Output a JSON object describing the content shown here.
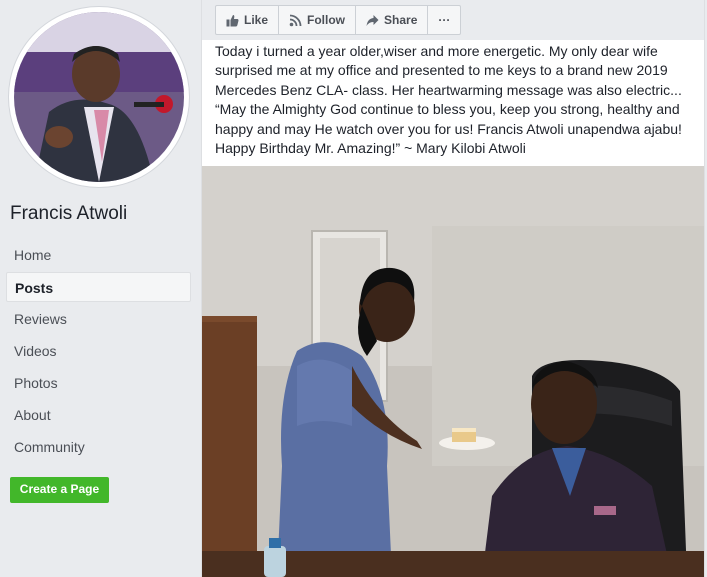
{
  "sidebar": {
    "page_name": "Francis Atwoli",
    "nav": [
      {
        "label": "Home"
      },
      {
        "label": "Posts"
      },
      {
        "label": "Reviews"
      },
      {
        "label": "Videos"
      },
      {
        "label": "Photos"
      },
      {
        "label": "About"
      },
      {
        "label": "Community"
      }
    ],
    "active_item": "Posts",
    "create_page_label": "Create a Page"
  },
  "actions": {
    "like_label": "Like",
    "follow_label": "Follow",
    "share_label": "Share",
    "more_label": "···"
  },
  "post": {
    "lines": [
      "Today i turned a year older,wiser and more energetic. My only dear wife",
      "surprised me at my office and presented to me keys to a brand new 2019",
      "Mercedes Benz CLA- class. Her heartwarming message was also electric...",
      "“May the Almighty God continue to bless you, keep you strong, healthy and",
      "happy and may He watch over you for us! Francis Atwoli unapendwa ajabu!",
      "Happy Birthday Mr. Amazing!” ~ Mary Kilobi Atwoli"
    ]
  },
  "colors": {
    "accent_green": "#42b72a",
    "sidebar_bg": "#e9ebee",
    "text": "#1d2129"
  }
}
